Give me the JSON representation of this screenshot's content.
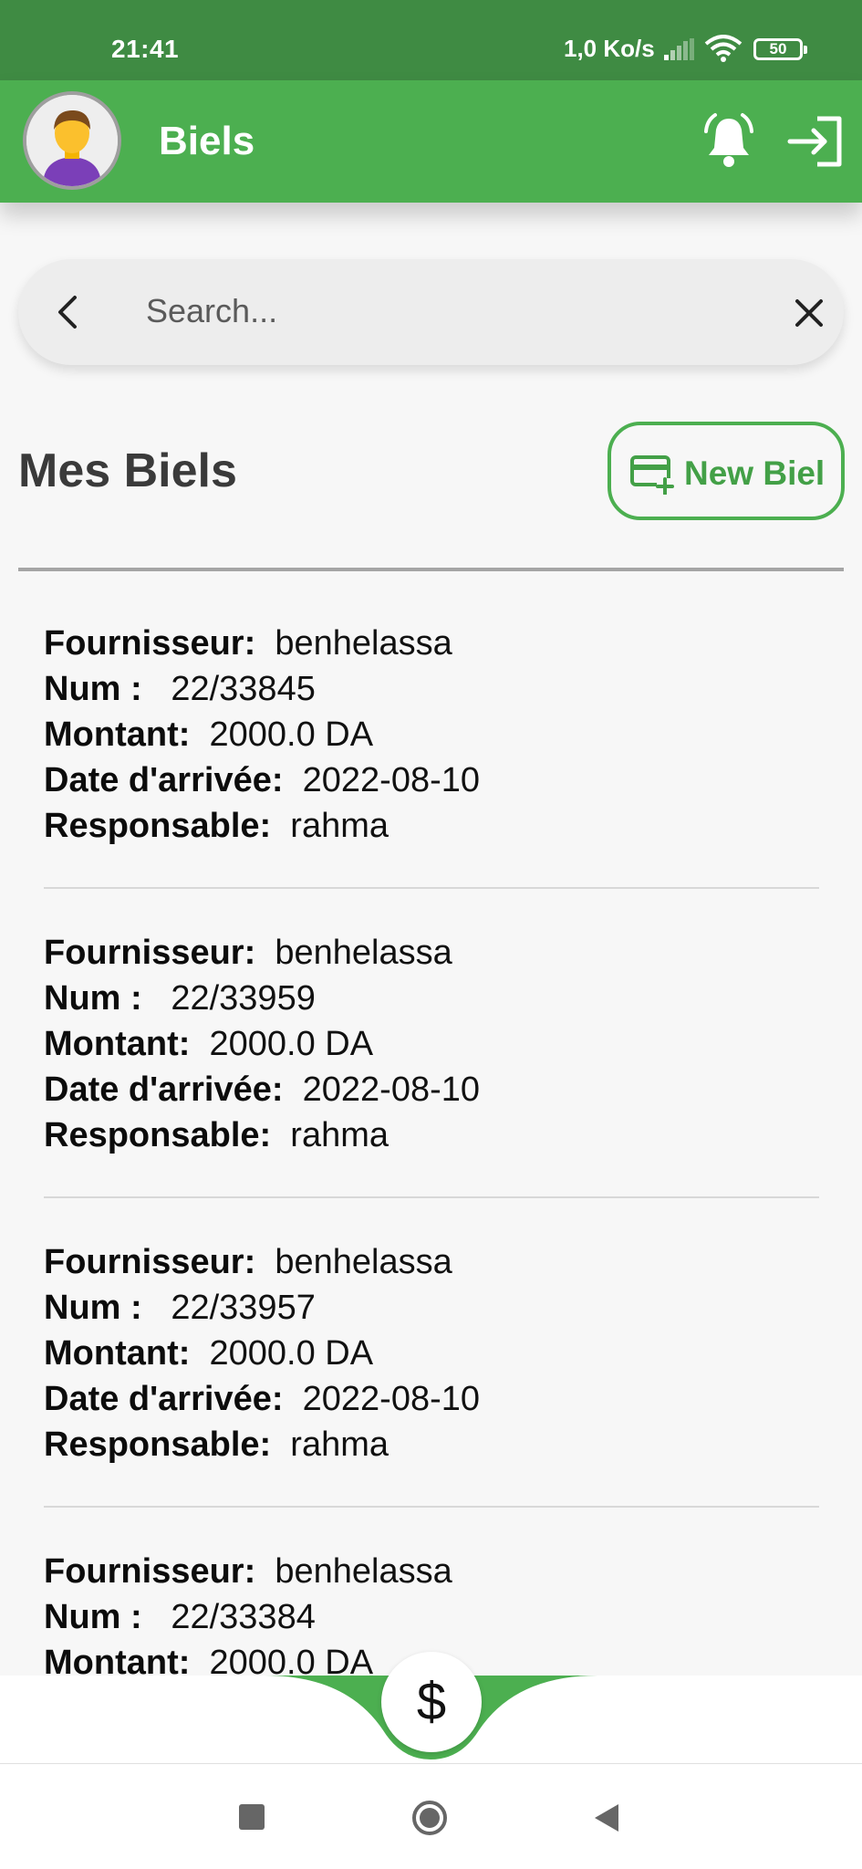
{
  "status_bar": {
    "time": "21:41",
    "network_speed": "1,0 Ko/s",
    "battery": "50",
    "icons": [
      "signal-icon",
      "wifi-icon",
      "battery-icon"
    ]
  },
  "app_bar": {
    "title": "Biels",
    "avatar_icon": "user-avatar",
    "actions": [
      "bell-icon",
      "logout-icon"
    ],
    "color": "#4caf50"
  },
  "search": {
    "placeholder": "Search...",
    "value": ""
  },
  "section": {
    "title": "Mes Biels",
    "new_button_label": "New Biel",
    "new_button_icon": "card-add-icon"
  },
  "labels": {
    "fournisseur": "Fournisseur:",
    "num": "Num :",
    "montant": "Montant:",
    "date": "Date d'arrivée:",
    "responsable": "Responsable:"
  },
  "biels": [
    {
      "fournisseur": "benhelassa",
      "num": "22/33845",
      "montant": "2000.0 DA",
      "date": "2022-08-10",
      "responsable": "rahma"
    },
    {
      "fournisseur": "benhelassa",
      "num": "22/33959",
      "montant": "2000.0 DA",
      "date": "2022-08-10",
      "responsable": "rahma"
    },
    {
      "fournisseur": "benhelassa",
      "num": "22/33957",
      "montant": "2000.0 DA",
      "date": "2022-08-10",
      "responsable": "rahma"
    },
    {
      "fournisseur": "benhelassa",
      "num": "22/33384",
      "montant": "2000.0 DA",
      "date": "",
      "responsable": ""
    }
  ],
  "bottom_nav": {
    "fab_label": "$",
    "accent": "#4caf50"
  }
}
